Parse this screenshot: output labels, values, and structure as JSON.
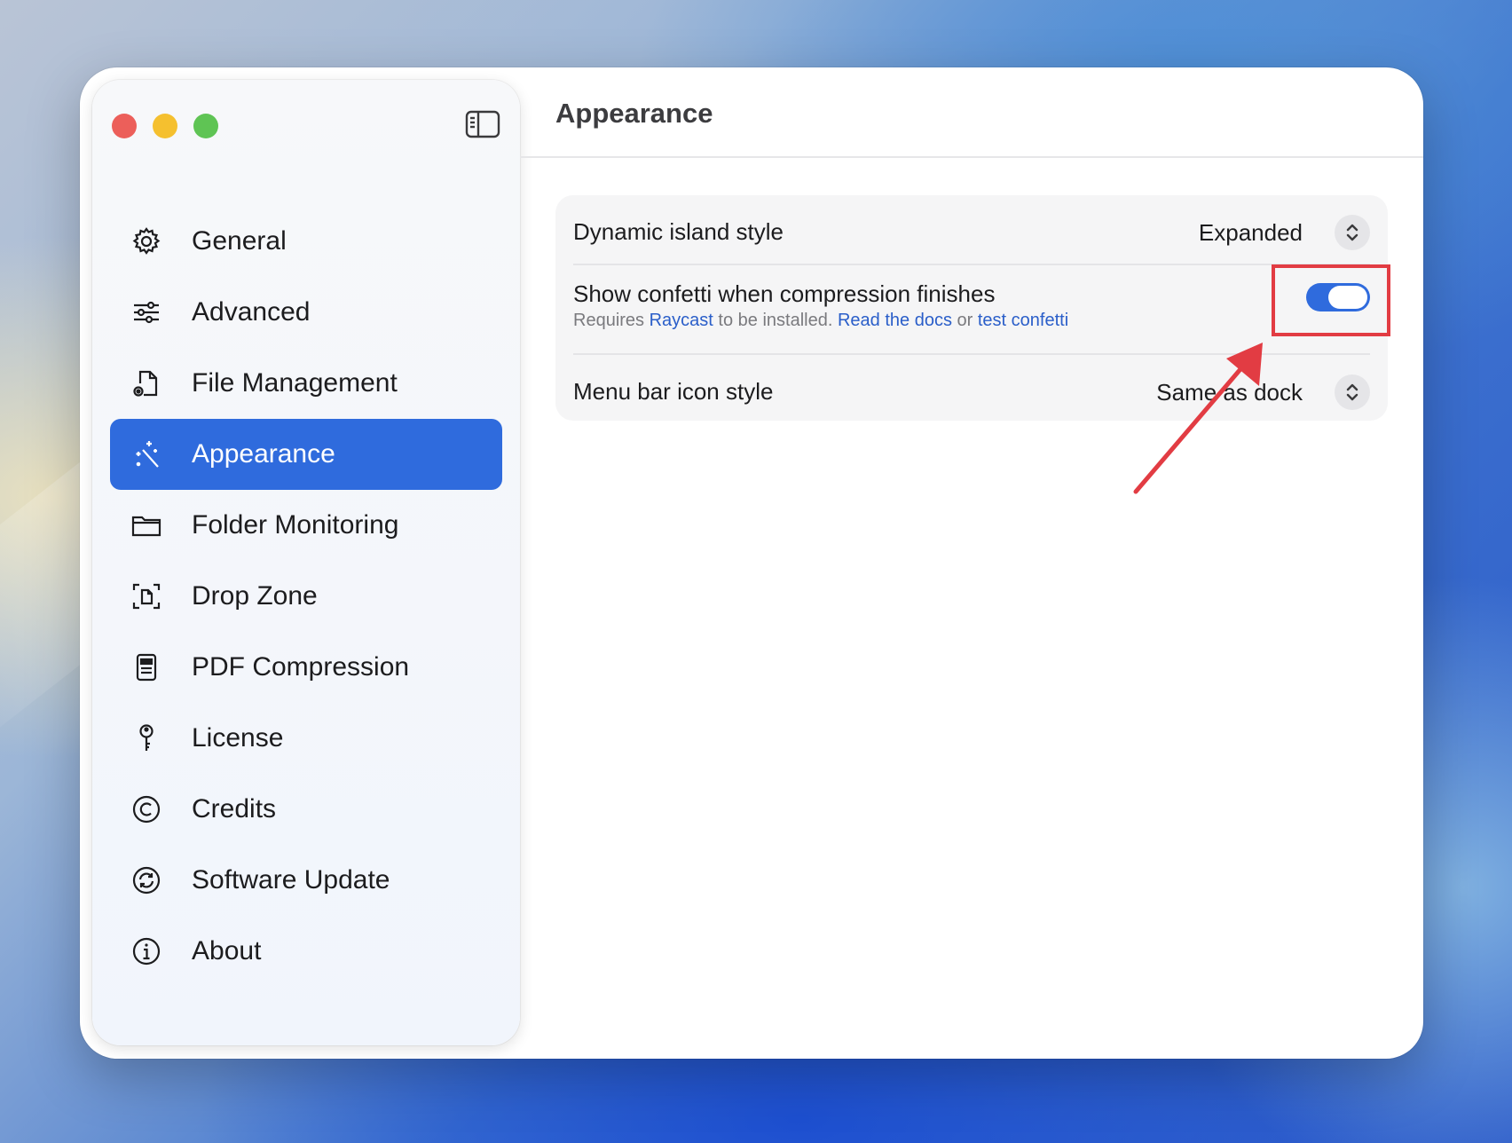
{
  "window": {
    "traffic_lights": [
      "close",
      "minimize",
      "zoom"
    ]
  },
  "sidebar": {
    "toggle_icon": "sidebar-toggle-icon",
    "items": [
      {
        "label": "General",
        "icon": "gear-icon",
        "selected": false
      },
      {
        "label": "Advanced",
        "icon": "sliders-icon",
        "selected": false
      },
      {
        "label": "File Management",
        "icon": "document-gear-icon",
        "selected": false
      },
      {
        "label": "Appearance",
        "icon": "magic-wand-icon",
        "selected": true
      },
      {
        "label": "Folder Monitoring",
        "icon": "folder-icon",
        "selected": false
      },
      {
        "label": "Drop Zone",
        "icon": "drop-zone-icon",
        "selected": false
      },
      {
        "label": "PDF Compression",
        "icon": "pdf-document-icon",
        "selected": false
      },
      {
        "label": "License",
        "icon": "key-icon",
        "selected": false
      },
      {
        "label": "Credits",
        "icon": "copyright-icon",
        "selected": false
      },
      {
        "label": "Software Update",
        "icon": "refresh-icon",
        "selected": false
      },
      {
        "label": "About",
        "icon": "info-icon",
        "selected": false
      }
    ]
  },
  "main": {
    "title": "Appearance",
    "settings": {
      "dynamic_island": {
        "label": "Dynamic island style",
        "value": "Expanded"
      },
      "confetti": {
        "label": "Show confetti when compression finishes",
        "sub_prefix": "Requires",
        "sub_link1": "Raycast",
        "sub_middle": "to be installed.",
        "sub_link2": "Read the docs",
        "sub_or": "or",
        "sub_link3": "test confetti",
        "enabled": true
      },
      "menu_bar_icon": {
        "label": "Menu bar icon style",
        "value": "Same as dock"
      }
    }
  },
  "annotation": {
    "color": "#e23c43"
  },
  "colors": {
    "accent": "#2f6bdd",
    "link": "#2a5ec9",
    "window_bg": "#ffffff"
  }
}
